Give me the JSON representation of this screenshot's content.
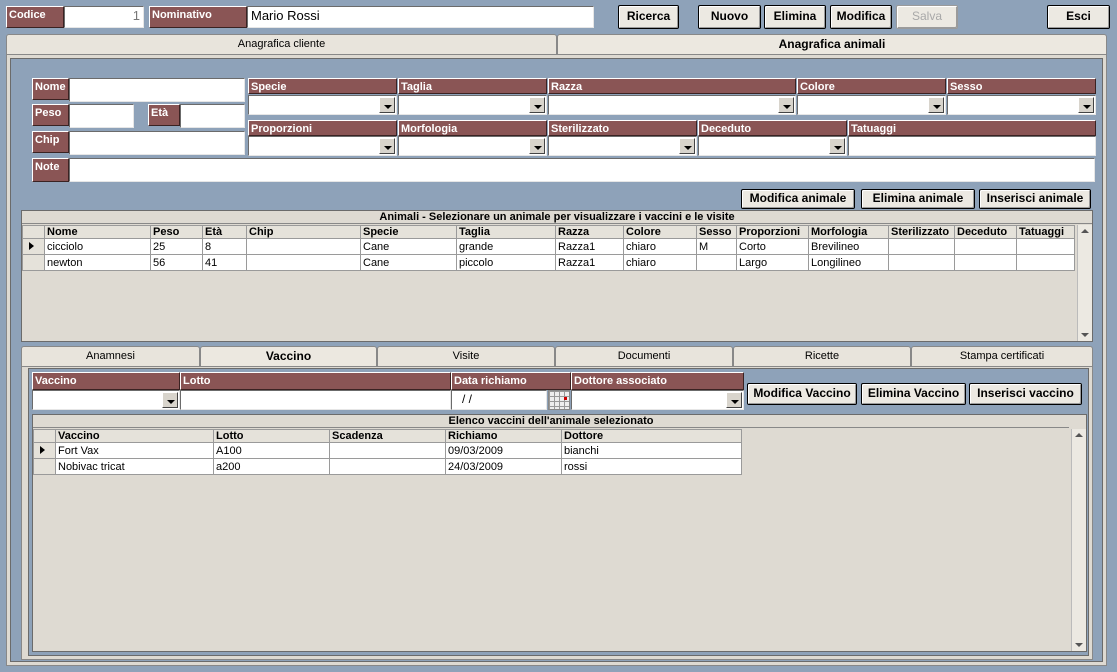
{
  "header": {
    "codice_label": "Codice",
    "codice_value": "1",
    "nominativo_label": "Nominativo",
    "nominativo_value": "Mario Rossi",
    "buttons": {
      "ricerca": "Ricerca",
      "nuovo": "Nuovo",
      "elimina": "Elimina",
      "modifica": "Modifica",
      "salva": "Salva",
      "esci": "Esci"
    }
  },
  "main_tabs": [
    "Anagrafica cliente",
    "Anagrafica animali"
  ],
  "animal_form": {
    "nome": "Nome",
    "peso": "Peso",
    "eta": "Età",
    "chip": "Chip",
    "note": "Note",
    "specie": "Specie",
    "taglia": "Taglia",
    "razza": "Razza",
    "colore": "Colore",
    "sesso": "Sesso",
    "proporzioni": "Proporzioni",
    "morfologia": "Morfologia",
    "sterilizzato": "Sterilizzato",
    "deceduto": "Deceduto",
    "tatuaggi": "Tatuaggi"
  },
  "animal_buttons": {
    "modifica": "Modifica animale",
    "elimina": "Elimina animale",
    "inserisci": "Inserisci animale"
  },
  "animals_grid": {
    "caption": "Animali - Selezionare un animale per visualizzare i vaccini e le visite",
    "columns": [
      "Nome",
      "Peso",
      "Età",
      "Chip",
      "Specie",
      "Taglia",
      "Razza",
      "Colore",
      "Sesso",
      "Proporzioni",
      "Morfologia",
      "Sterilizzato",
      "Deceduto",
      "Tatuaggi"
    ],
    "rows": [
      [
        "cicciolo",
        "25",
        "8",
        "",
        "Cane",
        "grande",
        "Razza1",
        "chiaro",
        "M",
        "Corto",
        "Brevilineo",
        "",
        "",
        ""
      ],
      [
        "newton",
        "56",
        "41",
        "",
        "Cane",
        "piccolo",
        "Razza1",
        "chiaro",
        "",
        "Largo",
        "Longilineo",
        "",
        "",
        ""
      ]
    ]
  },
  "sub_tabs": [
    "Anamnesi",
    "Vaccino",
    "Visite",
    "Documenti",
    "Ricette",
    "Stampa certificati"
  ],
  "vaccine_form": {
    "vaccino": "Vaccino",
    "lotto": "Lotto",
    "data_richiamo": "Data richiamo",
    "data_value": " /  /",
    "dottore": "Dottore associato"
  },
  "vaccine_buttons": {
    "modifica": "Modifica Vaccino",
    "elimina": "Elimina Vaccino",
    "inserisci": "Inserisci vaccino"
  },
  "vaccines_grid": {
    "caption": "Elenco vaccini dell'animale selezionato",
    "columns": [
      "Vaccino",
      "Lotto",
      "Scadenza",
      "Richiamo",
      "Dottore"
    ],
    "rows": [
      [
        "Fort Vax",
        "A100",
        "",
        "09/03/2009",
        "bianchi"
      ],
      [
        "Nobivac tricat",
        "a200",
        "",
        "24/03/2009",
        "rossi"
      ]
    ]
  }
}
